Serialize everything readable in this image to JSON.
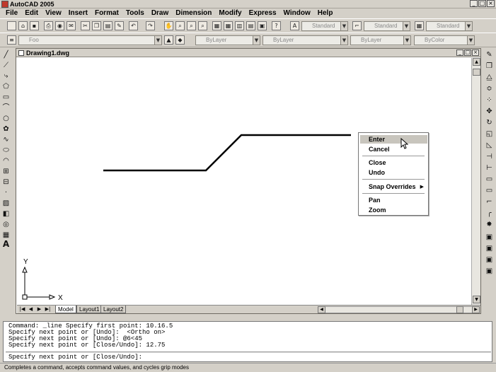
{
  "app": {
    "title": "AutoCAD 2005"
  },
  "menu": [
    "File",
    "Edit",
    "View",
    "Insert",
    "Format",
    "Tools",
    "Draw",
    "Dimension",
    "Modify",
    "Express",
    "Window",
    "Help"
  ],
  "styles_toolbar": {
    "text_style": "Standard",
    "dim_style": "Standard",
    "table_style": "Standard"
  },
  "layers_toolbar": {
    "layer": "Foo"
  },
  "properties_toolbar": {
    "color": "ByLayer",
    "linetype": "ByLayer",
    "lineweight": "ByLayer",
    "plot_style": "ByColor"
  },
  "document": {
    "title": "Drawing1.dwg"
  },
  "ucs": {
    "x_label": "X",
    "y_label": "Y"
  },
  "layout_tabs": [
    "Model",
    "Layout1",
    "Layout2"
  ],
  "context_menu": {
    "items": [
      {
        "label": "Enter",
        "highlighted": true
      },
      {
        "label": "Cancel"
      },
      {
        "label": "Close"
      },
      {
        "label": "Undo"
      },
      {
        "label": "Snap Overrides",
        "submenu": true
      },
      {
        "label": "Pan"
      },
      {
        "label": "Zoom"
      }
    ]
  },
  "command_history": [
    "Command: _line Specify first point: 10.16.5",
    "Specify next point or [Undo]:  <Ortho on>",
    "Specify next point or [Undo]: @6<45",
    "Specify next point or [Close/Undo]: 12.75"
  ],
  "command_prompt": "Specify next point or [Close/Undo]:",
  "status_text": "Completes a command, accepts command values, and cycles grip modes",
  "icons": {
    "left_toolbar": [
      "line-icon",
      "construction-line-icon",
      "polyline-icon",
      "polygon-icon",
      "rectangle-icon",
      "arc-icon",
      "circle-icon",
      "revision-cloud-icon",
      "spline-icon",
      "ellipse-icon",
      "ellipse-arc-icon",
      "insert-block-icon",
      "make-block-icon",
      "point-icon",
      "hatch-icon",
      "gradient-icon",
      "region-icon",
      "table-icon",
      "multiline-text-icon"
    ],
    "right_toolbar": [
      "erase-icon",
      "copy-icon",
      "mirror-icon",
      "offset-icon",
      "array-icon",
      "move-icon",
      "rotate-icon",
      "scale-icon",
      "stretch-icon",
      "trim-icon",
      "extend-icon",
      "break-at-point-icon",
      "break-icon",
      "chamfer-icon",
      "fillet-icon",
      "explode-icon",
      "draworder-front-icon",
      "draworder-back-icon",
      "bring-above-icon",
      "send-under-icon"
    ]
  }
}
